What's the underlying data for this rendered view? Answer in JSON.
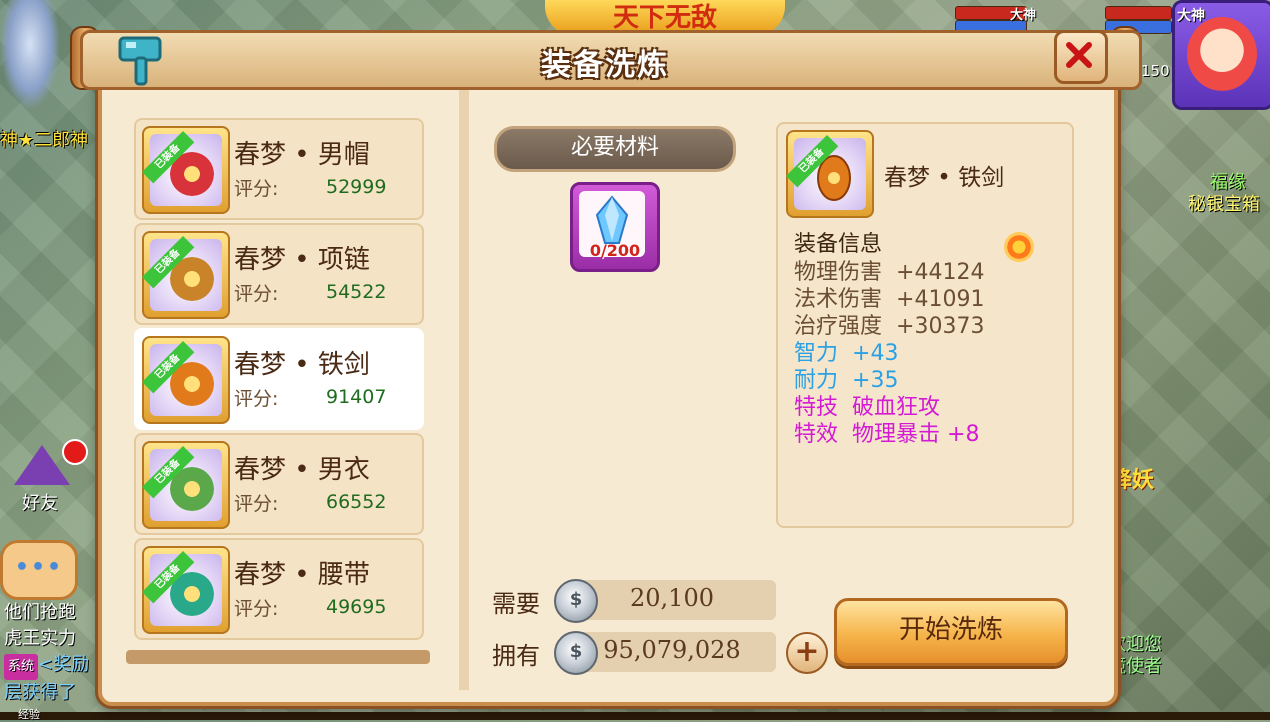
{
  "background": {
    "left_player_name": "神★二郎神",
    "top_banner": "天下无敌",
    "level_text": "转150",
    "hud_tag_1": "大神",
    "hud_tag_2": "大神",
    "npc_name_1": "福缘",
    "npc_name_2": "秘银宝箱",
    "event_text": "降妖",
    "welcome_line_1": "欢迎您",
    "welcome_line_2": "镜使者",
    "friend_label": "好友",
    "chat_bubble": "•••",
    "chat_line_1": "他们抢跑",
    "chat_line_2": "虎王实力",
    "chat_sys_tag": "系统",
    "chat_line_3": "<奖励",
    "chat_line_4": "层获得了",
    "xp_label": "经验"
  },
  "dialog": {
    "title": "装备洗炼",
    "close_label": "✕"
  },
  "equipment_list": [
    {
      "name": "春梦 • 男帽",
      "score_label": "评分:",
      "score": "52999",
      "tag": "已装备",
      "selected": false,
      "color": "#d8323a"
    },
    {
      "name": "春梦 • 项链",
      "score_label": "评分:",
      "score": "54522",
      "tag": "已装备",
      "selected": false,
      "color": "#c9842a"
    },
    {
      "name": "春梦 • 铁剑",
      "score_label": "评分:",
      "score": "91407",
      "tag": "已装备",
      "selected": true,
      "color": "#e07a1a"
    },
    {
      "name": "春梦 • 男衣",
      "score_label": "评分:",
      "score": "66552",
      "tag": "已装备",
      "selected": false,
      "color": "#5aa84a"
    },
    {
      "name": "春梦 • 腰带",
      "score_label": "评分:",
      "score": "49695",
      "tag": "已装备",
      "selected": false,
      "color": "#2aa88a"
    }
  ],
  "material": {
    "label": "必要材料",
    "count": "0/200"
  },
  "info": {
    "name": "春梦 • 铁剑",
    "tag": "已装备",
    "heading": "装备信息",
    "stats": [
      {
        "label": "物理伤害",
        "value": "+44124",
        "color": "#6b4e34"
      },
      {
        "label": "法术伤害",
        "value": "+41091",
        "color": "#6b4e34"
      },
      {
        "label": "治疗强度",
        "value": "+30373",
        "color": "#6b4e34"
      },
      {
        "label": "智力",
        "value": "+43",
        "color": "#2aa0e6"
      },
      {
        "label": "耐力",
        "value": "+35",
        "color": "#2aa0e6"
      },
      {
        "label": "特技",
        "value": "破血狂攻",
        "color": "#d41ad4"
      },
      {
        "label": "特效",
        "value": "物理暴击  +8",
        "color": "#d41ad4"
      }
    ]
  },
  "cost": {
    "need_label": "需要",
    "need_value": "20,100",
    "own_label": "拥有",
    "own_value": "95,079,028",
    "coin_symbol": "$"
  },
  "actions": {
    "add_label": "+",
    "start_label": "开始洗炼"
  },
  "colors": {
    "panel_bg": "#f7ead2",
    "panel_border": "#c98e4c",
    "accent_orange": "#f6b44a",
    "material_purple": "#9a2ea6"
  }
}
